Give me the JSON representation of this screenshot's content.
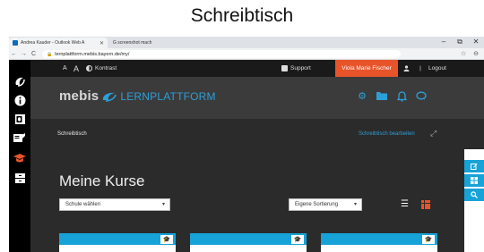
{
  "caption": "Schreibtisch",
  "browser": {
    "tab_active": "Andrea Kauder - Outlook Web A",
    "tab_active_close": "✕",
    "tab_inactive": "G screenshot mach",
    "url": "lernplattform.mebis.bayern.de/my/",
    "nav": {
      "back": "←",
      "forward": "→",
      "reload": "C"
    },
    "window_controls": {
      "minimize": "–",
      "maximize": "⧉",
      "close": "✕"
    },
    "omnibox_icons": {
      "star": "☆",
      "account": "⊖"
    }
  },
  "topnav": {
    "font_small": "A",
    "font_large": "A",
    "contrast_label": "Kontrast",
    "support_label": "Support",
    "user_name": "Viola Marie Fischer",
    "logout_label": "Logout"
  },
  "brand": {
    "name_bold": "mebis",
    "name_rest": "LERNPLATTFORM"
  },
  "breadcrumb": {
    "current": "Schreibtisch",
    "edit_label": "Schreibtisch bearbeiten"
  },
  "main": {
    "title": "Meine Kurse",
    "school_select": "Schule wählen",
    "sort_select": "Eigene Sortierung"
  },
  "colors": {
    "accent_blue": "#17a2d8",
    "accent_orange": "#e8542a",
    "dark_bg": "#2b2b2b"
  },
  "icons": [
    "mebis-logo-icon",
    "info-icon",
    "outlook-icon",
    "certificate-icon",
    "graduation-cap-icon",
    "archive-icon",
    "gear-icon",
    "folder-icon",
    "bell-icon",
    "chat-icon",
    "edit-icon",
    "grid-icon",
    "search-icon"
  ]
}
